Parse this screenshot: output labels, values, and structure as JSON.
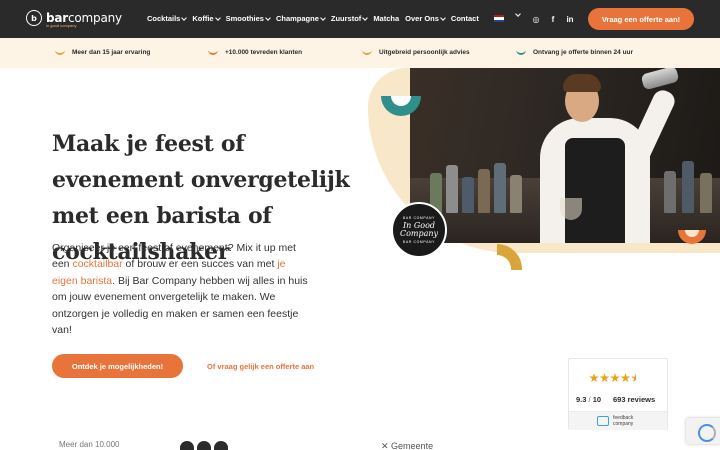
{
  "nav": {
    "logo": {
      "mark": "b",
      "name_bold": "bar",
      "name_light": "company",
      "tagline": "in good company"
    },
    "menu": [
      {
        "label": "Cocktails",
        "has_dropdown": true
      },
      {
        "label": "Koffie",
        "has_dropdown": true
      },
      {
        "label": "Smoothies",
        "has_dropdown": true
      },
      {
        "label": "Champagne",
        "has_dropdown": true
      },
      {
        "label": "Zuurstof",
        "has_dropdown": true
      },
      {
        "label": "Matcha",
        "has_dropdown": false
      },
      {
        "label": "Over Ons",
        "has_dropdown": true
      },
      {
        "label": "Contact",
        "has_dropdown": false
      }
    ],
    "language_flag": "netherlands-flag-icon",
    "social": [
      {
        "icon": "instagram-icon",
        "glyph": "◎"
      },
      {
        "icon": "facebook-icon",
        "glyph": "f"
      },
      {
        "icon": "linkedin-icon",
        "glyph": "in"
      }
    ],
    "cta_label": "Vraag een offerte aan!"
  },
  "usp": [
    {
      "text": "Meer dan 15 jaar ervaring",
      "color": "#d9a43a"
    },
    {
      "text": "+10.000 tevreden klanten",
      "color": "#e8743b"
    },
    {
      "text": "Uitgebreid persoonlijk advies",
      "color": "#d9a43a"
    },
    {
      "text": "Ontvang je offerte binnen 24 uur",
      "color": "#2f8f8b"
    }
  ],
  "hero": {
    "headline": "Maak je feest of evenement onvergetelijk met een barista of cocktailshaker",
    "intro": {
      "p1": "Organiseer je een feest of evenement? Mix it up met een ",
      "link1": "cocktailbar",
      "p2": " of brouw er een succes van met ",
      "link2": "je eigen barista",
      "p3": ". Bij Bar Company hebben wij alles in huis om jouw evenement onvergetelijk te maken. We ontzorgen je volledig en maken er samen een feestje van!"
    },
    "cta_primary": "Ontdek je mogelijkheden!",
    "cta_secondary": "Of vraag gelijk een offerte aan",
    "badge": {
      "top": "BAR COMPANY",
      "main": "In Good Company",
      "bottom": "BAR COMPANY"
    }
  },
  "review_widget": {
    "stars": 4.5,
    "score": "9.3",
    "scale": "10",
    "count_label": "693 reviews",
    "provider_line1": "feedback",
    "provider_line2": "company"
  },
  "bottom": {
    "note": "Meer dan 10.000",
    "municipality": "Gemeente"
  },
  "colors": {
    "nav_bg": "#2a2a2a",
    "accent_orange": "#e8743b",
    "accent_teal": "#2f8f8b",
    "accent_mustard": "#d9a43a",
    "cream": "#fdf4e6"
  }
}
